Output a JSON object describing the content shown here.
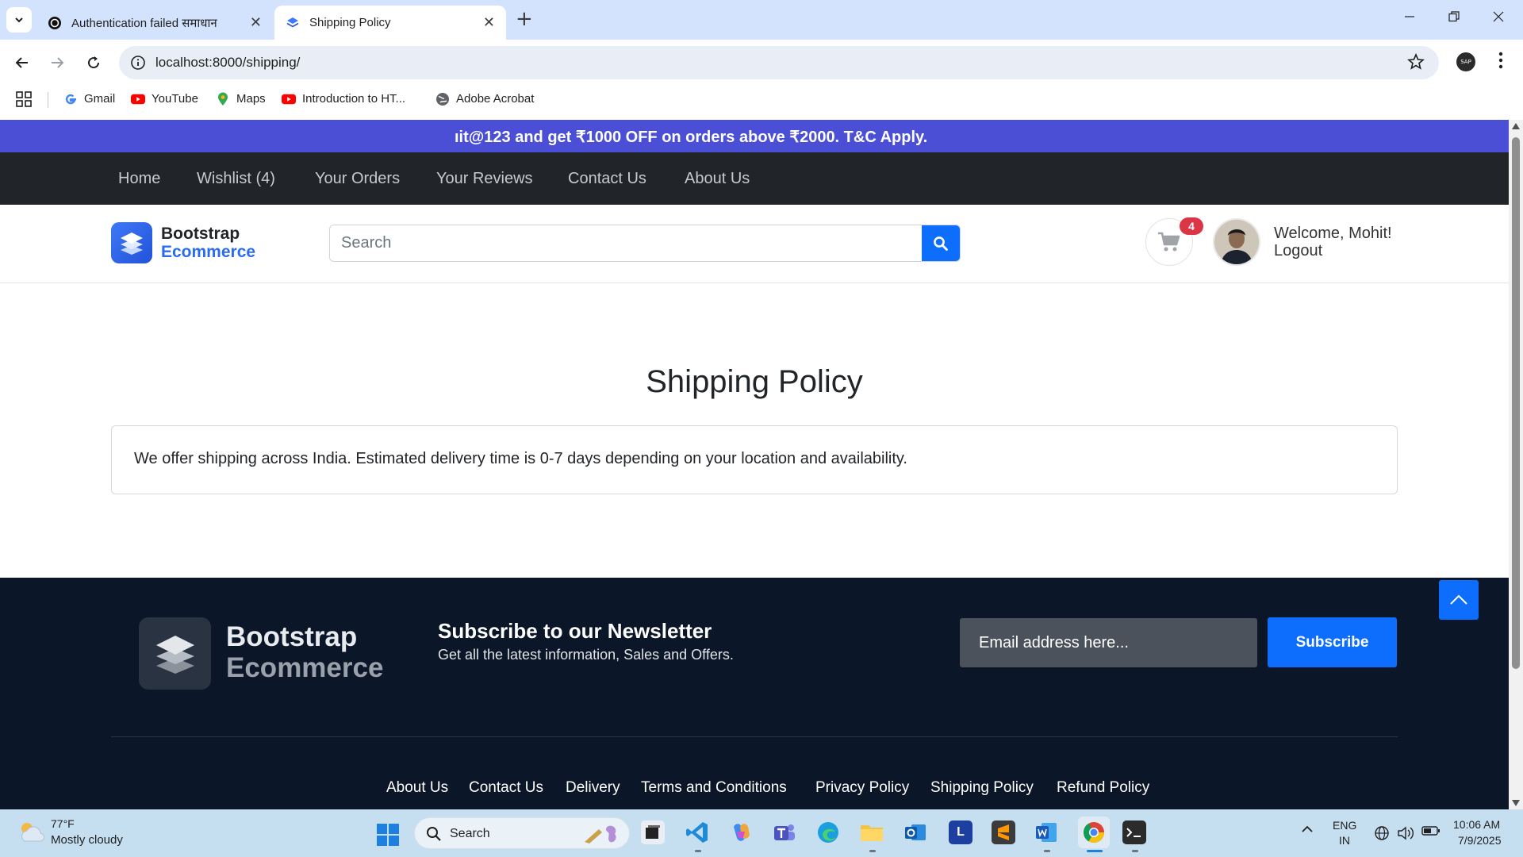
{
  "browser": {
    "tabs": [
      {
        "title": "Authentication failed समाधान",
        "active": false
      },
      {
        "title": "Shipping Policy",
        "active": true
      }
    ],
    "url": "localhost:8000/shipping/",
    "profile_label": "SAP",
    "bookmarks": [
      {
        "label": "Gmail",
        "icon": "google-icon"
      },
      {
        "label": "YouTube",
        "icon": "youtube-icon"
      },
      {
        "label": "Maps",
        "icon": "maps-icon"
      },
      {
        "label": "Introduction to HT...",
        "icon": "youtube-icon"
      },
      {
        "label": "Adobe Acrobat",
        "icon": "globe-icon"
      }
    ]
  },
  "site": {
    "promo_text": "ıit@123 and get ₹1000 OFF on orders above ₹2000. T&C Apply.",
    "nav": [
      "Home",
      "Wishlist (4)",
      "Your Orders",
      "Your Reviews",
      "Contact Us",
      "About Us"
    ],
    "brand": {
      "line1": "Bootstrap",
      "line2": "Ecommerce"
    },
    "search_placeholder": "Search",
    "cart_count": "4",
    "welcome": "Welcome, Mohit!",
    "logout": "Logout",
    "accent_color": "#0d6efd",
    "promo_color": "#4a4fd6"
  },
  "main": {
    "title": "Shipping Policy",
    "body": "We offer shipping across India. Estimated delivery time is 0-7 days depending on your location and availability."
  },
  "footer": {
    "brand": {
      "line1": "Bootstrap",
      "line2": "Ecommerce"
    },
    "newsletter_title": "Subscribe to our Newsletter",
    "newsletter_sub": "Get all the latest information, Sales and Offers.",
    "email_placeholder": "Email address here...",
    "subscribe_label": "Subscribe",
    "links": [
      "About Us",
      "Contact Us",
      "Delivery",
      "Terms and Conditions",
      "Privacy Policy",
      "Shipping Policy",
      "Refund Policy"
    ]
  },
  "taskbar": {
    "weather_temp": "77°F",
    "weather_desc": "Mostly cloudy",
    "search_label": "Search",
    "lang_line1": "ENG",
    "lang_line2": "IN",
    "time": "10:06 AM",
    "date": "7/9/2025",
    "apps": [
      "file-explorer-app",
      "vscode-app",
      "copilot-app",
      "teams-app",
      "edge-app",
      "files-app",
      "outlook-app",
      "l-app",
      "sublime-app",
      "word-app",
      "chrome-app",
      "terminal-app"
    ]
  }
}
